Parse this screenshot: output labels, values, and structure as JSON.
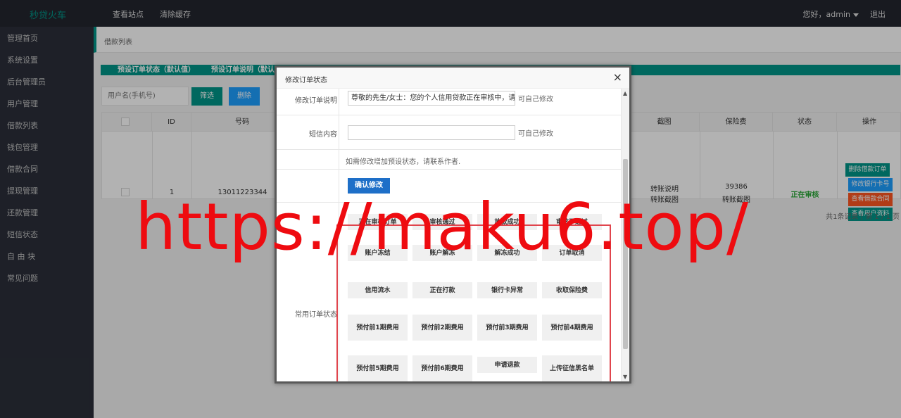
{
  "header": {
    "logo": "秒贷火车",
    "nav": [
      "查看站点",
      "清除缓存"
    ],
    "user": "您好，admin",
    "logout": "退出"
  },
  "sidebar": {
    "items": [
      "管理首页",
      "系统设置",
      "后台管理员",
      "用户管理",
      "借款列表",
      "钱包管理",
      "借款合同",
      "提现管理",
      "还款管理",
      "短信状态",
      "自 由 块",
      "常见问题"
    ]
  },
  "main": {
    "breadcrumb": "借款列表",
    "status_bar": [
      "预设订单状态（默认值）",
      "预设订单说明（默认"
    ],
    "search_placeholder": "用户名(手机号)",
    "filter_label": "筛选",
    "delete_label": "删除",
    "table": {
      "headers": [
        "ID",
        "号码",
        "截图",
        "保险费",
        "状态",
        "操作"
      ],
      "row": {
        "id": "1",
        "phone": "13011223344",
        "screenshot": [
          "转账说明",
          "转账截图"
        ],
        "insurance": [
          "39386",
          "转账截图"
        ],
        "status": "正在审核"
      },
      "ops": [
        "删除借款订单",
        "修改银行卡号",
        "查看借款合同",
        "查看用户资料"
      ]
    },
    "pager": "共1条记录 | 第 1 / 1 页"
  },
  "modal": {
    "title": "修改订单状态",
    "close": "×",
    "rows": {
      "desc_label": "修改订单说明",
      "desc_value": "尊敬的先生/女士：您的个人信用贷款正在审核中，请耐心等待",
      "desc_hint": "可自己修改",
      "sms_label": "短信内容",
      "sms_value": "",
      "sms_hint": "可自己修改",
      "note": "如需修改增加预设状态，请联系作者.",
      "confirm": "确认修改",
      "common_label": "常用订单状态"
    },
    "status_buttons": [
      "正在审核订单",
      "审核通过",
      "放款成功",
      "审核不通过",
      "账户冻结",
      "账户解冻",
      "解冻成功",
      "订单取消",
      "信用流水",
      "正在打款",
      "银行卡异常",
      "收取保险费",
      "预付前1期费用",
      "预付前2期费用",
      "预付前3期费用",
      "预付前4期费用",
      "预付前5期费用",
      "预付前6期费用",
      "申请退款",
      "上传征信黑名单"
    ]
  },
  "watermark": "https://maku6.top/",
  "colors": {
    "accent": "#009688",
    "primary": "#1e9fff",
    "danger": "#ff5722",
    "watermark": "#ee0b10"
  }
}
